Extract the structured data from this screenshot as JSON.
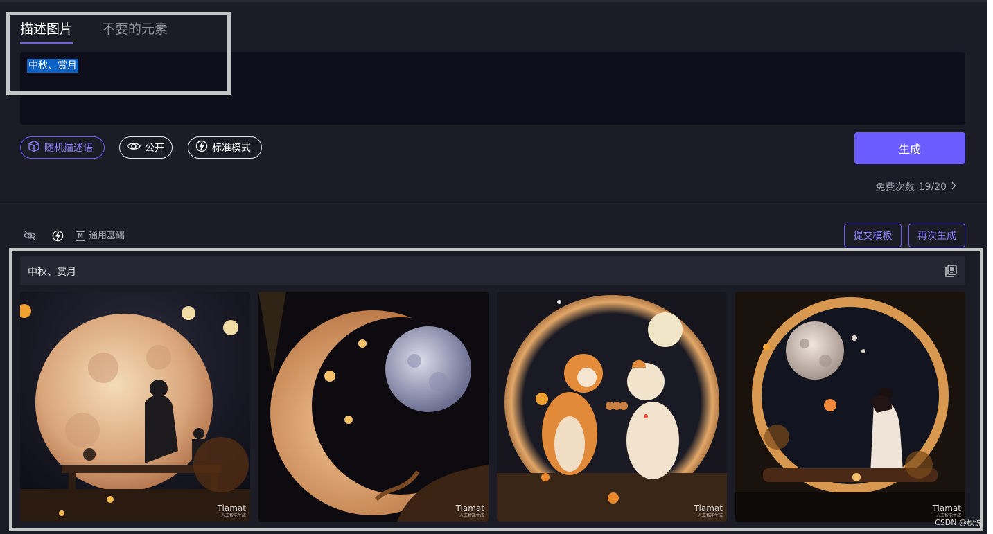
{
  "tabs": [
    {
      "label": "描述图片",
      "active": true
    },
    {
      "label": "不要的元素",
      "active": false
    }
  ],
  "prompt": {
    "value": "中秋、赏月"
  },
  "options": {
    "random_label": "随机描述语",
    "public_label": "公开",
    "mode_label": "标准模式"
  },
  "generate_label": "生成",
  "free_count": {
    "label": "免费次数",
    "value": "19/20"
  },
  "toolbar": {
    "model_label": "通用基础",
    "submit_template_label": "提交模板",
    "regenerate_label": "再次生成"
  },
  "result": {
    "prompt_text": "中秋、赏月",
    "images": [
      {
        "subject": "man and child watching full moon",
        "watermark": "Tiamat",
        "watermark_sub": "人工智能生成"
      },
      {
        "subject": "crescent moon with full moon",
        "watermark": "Tiamat",
        "watermark_sub": "人工智能生成"
      },
      {
        "subject": "two cats holding mooncakes under moon",
        "watermark": "Tiamat",
        "watermark_sub": "人工智能生成"
      },
      {
        "subject": "girl holding lantern in moon circle",
        "watermark": "Tiamat",
        "watermark_sub": "人工智能生成"
      }
    ]
  },
  "corner_credit": "CSDN @秋说",
  "colors": {
    "background": "#1c1c26",
    "accent": "#6a5cff",
    "prompt_box": "#0e0d1a",
    "result_bar": "#272733"
  }
}
